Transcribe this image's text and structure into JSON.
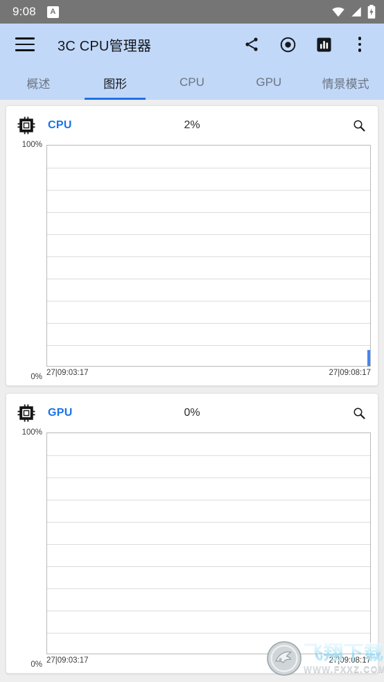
{
  "status_bar": {
    "time": "9:08",
    "badge_letter": "A",
    "icons": [
      "wifi-icon",
      "signal-icon",
      "battery-charging-icon"
    ],
    "background": "#757575"
  },
  "app_bar": {
    "menu_icon": "hamburger-menu-icon",
    "title": "3C CPU管理器",
    "background": "#c2d8f8",
    "actions": [
      {
        "name": "share-icon",
        "label": "分享"
      },
      {
        "name": "record-icon",
        "label": "录制"
      },
      {
        "name": "bar-chart-icon",
        "label": "统计"
      },
      {
        "name": "overflow-menu-icon",
        "label": "更多"
      }
    ]
  },
  "tabs": {
    "accent": "#1a73e8",
    "items": [
      {
        "label": "概述",
        "active": false
      },
      {
        "label": "图形",
        "active": true
      },
      {
        "label": "CPU",
        "active": false
      },
      {
        "label": "GPU",
        "active": false
      },
      {
        "label": "情景模式",
        "active": false
      }
    ]
  },
  "cards": [
    {
      "icon": "cpu-chip-icon",
      "label": "CPU",
      "label_color": "#1a73e8",
      "value": "2%",
      "search_icon": "search-icon",
      "chart": {
        "type": "line",
        "title": "CPU",
        "ylabel_top": "100%",
        "ylabel_bottom": "0%",
        "ylim": [
          0,
          100
        ],
        "gridlines": [
          10,
          20,
          30,
          40,
          50,
          60,
          70,
          80,
          90
        ],
        "xlabel_start": "27|09:03:17",
        "xlabel_end": "27|09:08:17",
        "series_color": "#4285f4",
        "current_value": 2,
        "marker_at_right": true
      }
    },
    {
      "icon": "cpu-chip-icon",
      "label": "GPU",
      "label_color": "#1a73e8",
      "value": "0%",
      "search_icon": "search-icon",
      "chart": {
        "type": "line",
        "title": "GPU",
        "ylabel_top": "100%",
        "ylabel_bottom": "0%",
        "ylim": [
          0,
          100
        ],
        "gridlines": [
          10,
          20,
          30,
          40,
          50,
          60,
          70,
          80,
          90
        ],
        "xlabel_start": "27|09:03:17",
        "xlabel_end": "27|09:08:17",
        "series_color": "#4285f4",
        "current_value": 0,
        "marker_at_right": false
      }
    }
  ],
  "chart_data": [
    {
      "type": "line",
      "title": "CPU",
      "xlabel": "",
      "ylabel": "%",
      "ylim": [
        0,
        100
      ],
      "x_tick_labels": [
        "27|09:03:17",
        "27|09:08:17"
      ],
      "y_tick_labels": [
        "0%",
        "100%"
      ],
      "gridlines_percent": [
        10,
        20,
        30,
        40,
        50,
        60,
        70,
        80,
        90
      ],
      "grid": true,
      "legend": "none",
      "series": [
        {
          "name": "CPU",
          "color": "#4285f4",
          "values": [
            0,
            0,
            0,
            0,
            0,
            0,
            0,
            0,
            0,
            2
          ]
        }
      ],
      "current_value": 2,
      "units": "%"
    },
    {
      "type": "line",
      "title": "GPU",
      "xlabel": "",
      "ylabel": "%",
      "ylim": [
        0,
        100
      ],
      "x_tick_labels": [
        "27|09:03:17",
        "27|09:08:17"
      ],
      "y_tick_labels": [
        "0%",
        "100%"
      ],
      "gridlines_percent": [
        10,
        20,
        30,
        40,
        50,
        60,
        70,
        80,
        90
      ],
      "grid": true,
      "legend": "none",
      "series": [
        {
          "name": "GPU",
          "color": "#4285f4",
          "values": [
            0,
            0,
            0,
            0,
            0,
            0,
            0,
            0,
            0,
            0
          ]
        }
      ],
      "current_value": 0,
      "units": "%"
    }
  ],
  "watermark": {
    "cn_text": "飞翔下载",
    "url_text": "WWW.FXXZ.COM",
    "logo": "bird-logo-icon"
  }
}
